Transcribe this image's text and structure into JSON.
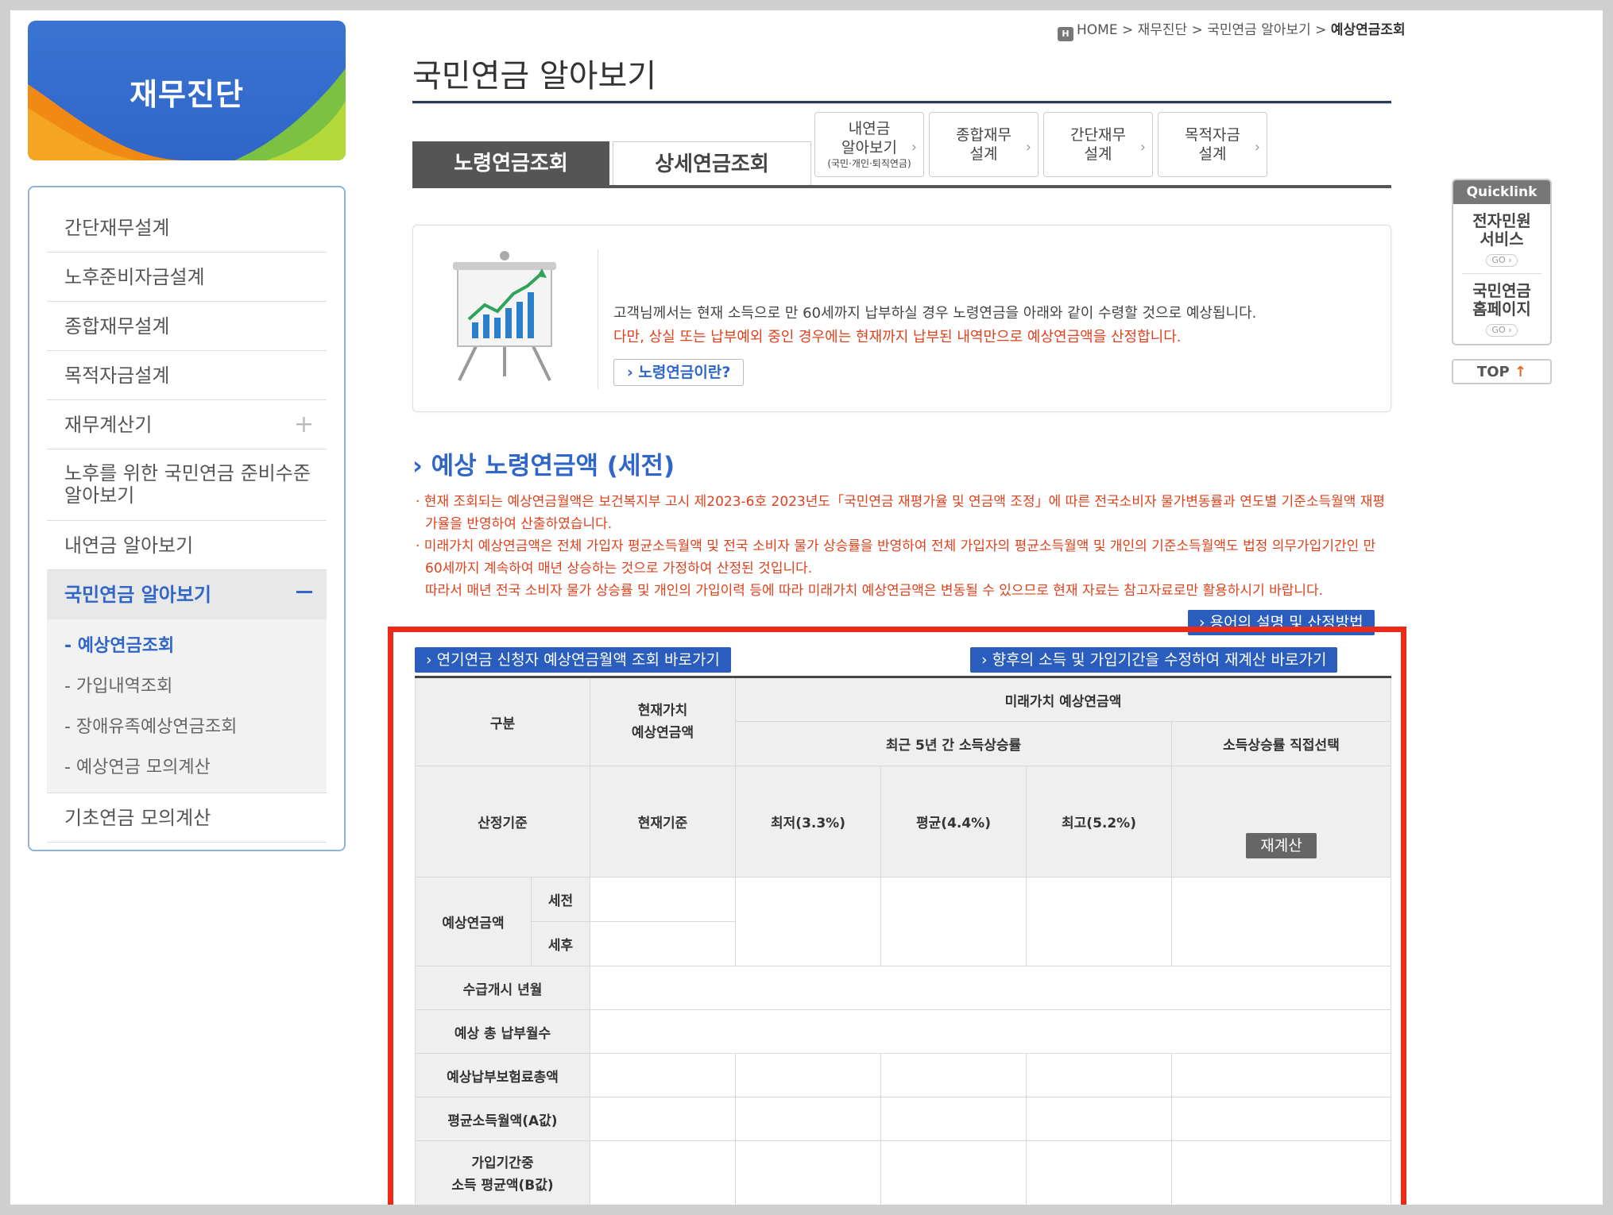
{
  "sidebar": {
    "banner_title": "재무진단",
    "items": [
      {
        "label": "간단재무설계"
      },
      {
        "label": "노후준비자금설계"
      },
      {
        "label": "종합재무설계"
      },
      {
        "label": "목적자금설계"
      },
      {
        "label": "재무계산기",
        "expand": "+"
      },
      {
        "label": "노후를 위한 국민연금 준비수준 알아보기"
      },
      {
        "label": "내연금 알아보기"
      },
      {
        "label": "국민연금 알아보기"
      },
      {
        "label": "기초연금 모의계산"
      }
    ],
    "submenu": [
      {
        "label": "- 예상연금조회"
      },
      {
        "label": "- 가입내역조회"
      },
      {
        "label": "- 장애유족예상연금조회"
      },
      {
        "label": "- 예상연금 모의계산"
      }
    ]
  },
  "breadcrumb": {
    "home_icon": "H",
    "path": "HOME > 재무진단 > 국민연금 알아보기 > ",
    "current": "예상연금조회"
  },
  "header": {
    "title": "국민연금 알아보기"
  },
  "tabs": {
    "main": [
      "노령연금조회",
      "상세연금조회"
    ],
    "small": [
      {
        "line1": "내연금",
        "line2": "알아보기",
        "line3": "(국민·개인·퇴직연금)"
      },
      {
        "line1": "종합재무",
        "line2": "설계"
      },
      {
        "line1": "간단재무",
        "line2": "설계"
      },
      {
        "line1": "목적자금",
        "line2": "설계"
      }
    ],
    "chevron": "›"
  },
  "info": {
    "text1": "고객님께서는 현재 소득으로 만 60세까지 납부하실 경우 노령연금을 아래와 같이 수령할 것으로 예상됩니다.",
    "text2": "다만, 상실 또는 납부예외 중인 경우에는 현재까지 납부된 내역만으로 예상연금액을 산정합니다.",
    "button": "› 노령연금이란?"
  },
  "section": {
    "title": "› 예상 노령연금액 (세전)",
    "notes": [
      "· 현재 조회되는 예상연금월액은 보건복지부 고시 제2023-6호 2023년도「국민연금 재평가율 및 연금액 조정」에 따른 전국소비자 물가변동률과 연도별 기준소득월액 재평가율을 반영하여 산출하였습니다.",
      "· 미래가치 예상연금액은 전체 가입자 평균소득월액 및 전국 소비자 물가 상승률을 반영하여 전체 가입자의 평균소득월액 및 개인의 기준소득월액도 법정 의무가입기간인 만 60세까지 계속하여 매년 상승하는 것으로 가정하여 산정된 것입니다.",
      "따라서 매년 전국 소비자 물가 상승률 및 개인의 가입이력 등에 따라 미래가치 예상연금액은 변동될 수 있으므로 현재 자료는 참고자료로만 활용하시기 바랍니다."
    ],
    "btn_terms": "› 용어의 설명 및 산정방법",
    "btn_deferred": "› 연기연금 신청자 예상연금월액 조회 바로가기",
    "btn_recalc_link": "› 향후의 소득 및 가입기간을 수정하여 재계산 바로가기"
  },
  "table": {
    "h_category": "구분",
    "h_current_value": "현재가치\n예상연금액",
    "h_future_value": "미래가치 예상연금액",
    "h_recent5": "최근 5년 간 소득상승률",
    "h_direct": "소득상승률 직접선택",
    "r_basis": "산정기준",
    "basis_current": "현재기준",
    "basis_min": "최저(3.3%)",
    "basis_avg": "평균(4.4%)",
    "basis_max": "최고(5.2%)",
    "recalc_button": "재계산",
    "r_expected": "예상연금액",
    "r_pretax": "세전",
    "r_aftertax": "세후",
    "r_start": "수급개시 년월",
    "r_months": "예상 총 납부월수",
    "r_premium": "예상납부보험료총액",
    "r_avg_income": "평균소득월액(A값)",
    "r_b_value": "가입기간중\n소득 평균액(B값)"
  },
  "quicklink": {
    "title": "Quicklink",
    "items": [
      {
        "label": "전자민원\n서비스",
        "go": "GO ›"
      },
      {
        "label": "국민연금\n홈페이지",
        "go": "GO ›"
      }
    ],
    "top": "TOP",
    "top_arrow": "↑"
  },
  "colors": {
    "brand_blue": "#2f66c8",
    "notice_red": "#e0401b",
    "highlight_red": "#ec2a1a"
  }
}
